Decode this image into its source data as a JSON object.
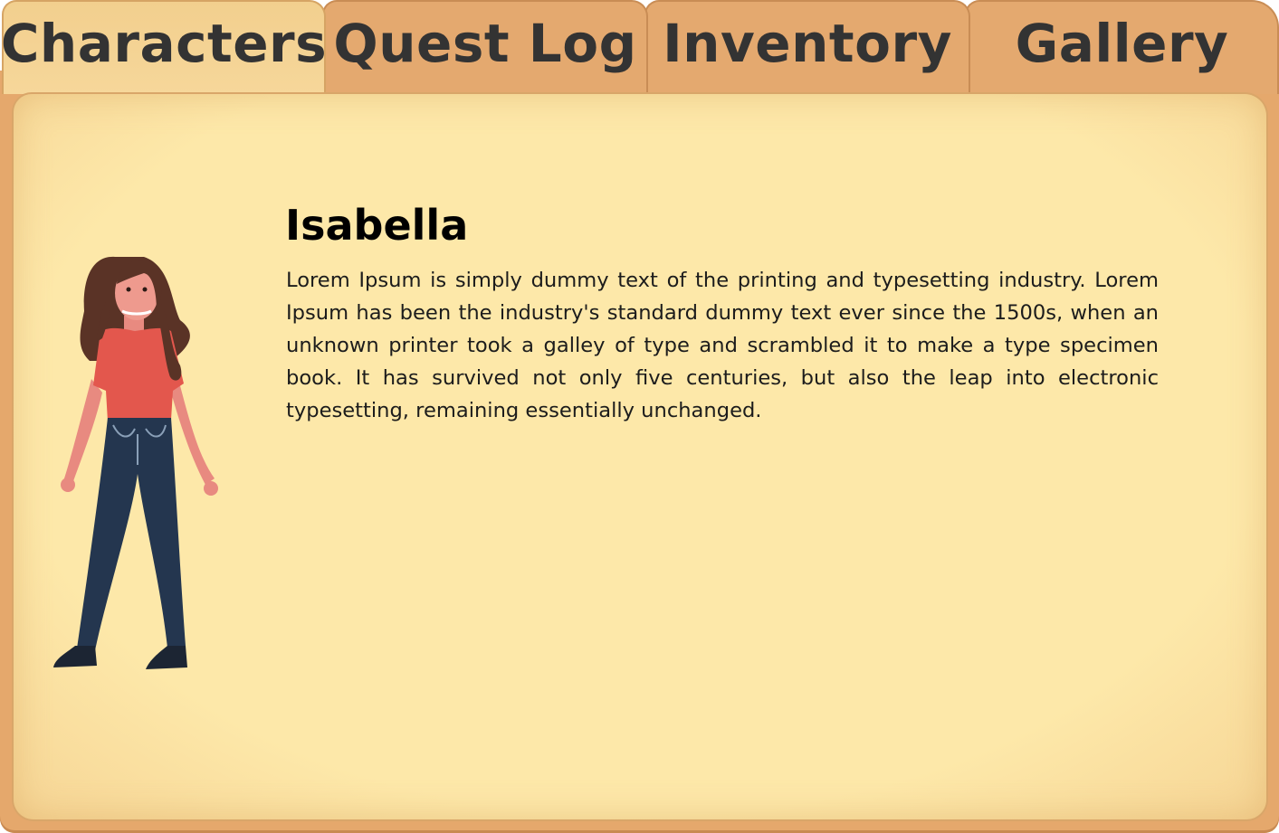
{
  "tabs": [
    {
      "label": "Characters",
      "active": true
    },
    {
      "label": "Quest Log",
      "active": false
    },
    {
      "label": "Inventory",
      "active": false
    },
    {
      "label": "Gallery",
      "active": false
    }
  ],
  "character": {
    "name": "Isabella",
    "bio": "Lorem Ipsum is simply dummy text of the printing and typesetting industry. Lorem Ipsum has been the industry's standard dummy text ever since the 1500s, when an unknown printer took a galley of type and scrambled it to make a type specimen book. It has survived not only five centuries, but also the leap into electronic typesetting, remaining essentially unchanged.",
    "portrait_icon": "girl-character-portrait"
  },
  "colors": {
    "cover": "#e4a96f",
    "active_tab": "#f2cf8e",
    "parchment": "#fde8a9",
    "text": "#333333"
  }
}
